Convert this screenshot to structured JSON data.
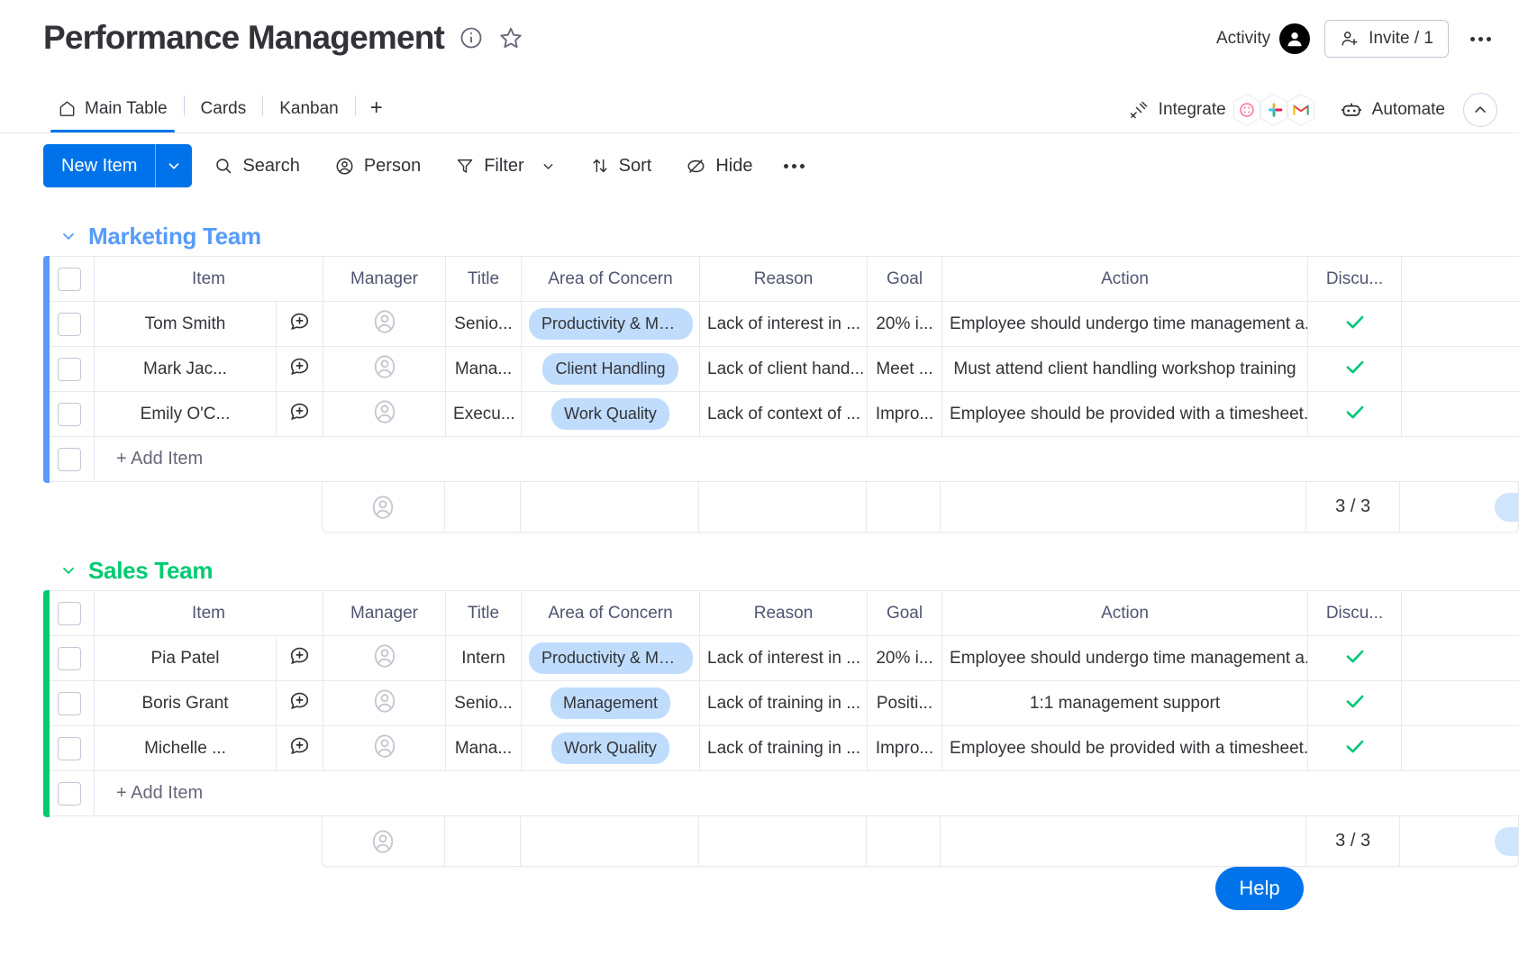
{
  "header": {
    "title": "Performance Management",
    "info_icon": "info-circle-icon",
    "star_icon": "star-icon",
    "activity_label": "Activity",
    "invite_label": "Invite / 1",
    "more_menu": "more-options-icon"
  },
  "tabs": {
    "items": [
      {
        "label": "Main Table",
        "icon": "home-icon",
        "active": true
      },
      {
        "label": "Cards",
        "icon": "",
        "active": false
      },
      {
        "label": "Kanban",
        "icon": "",
        "active": false
      }
    ],
    "add_label": "+",
    "integrate_label": "Integrate",
    "integrate_icons": [
      "monday-integration-icon",
      "slack-icon",
      "gmail-icon"
    ],
    "automate_label": "Automate",
    "collapse_icon": "chevron-up-icon"
  },
  "toolbar": {
    "new_item_label": "New Item",
    "new_item_caret": "chevron-down-icon",
    "search_label": "Search",
    "person_label": "Person",
    "filter_label": "Filter",
    "filter_caret": "chevron-down-icon",
    "sort_label": "Sort",
    "hide_label": "Hide",
    "more_label": "more-actions-icon"
  },
  "columns": [
    "Item",
    "",
    "Manager",
    "Title",
    "Area of Concern",
    "Reason",
    "Goal",
    "Action",
    "Discu..."
  ],
  "groups": [
    {
      "name": "Marketing Team",
      "color": "#579bfc",
      "add_item_label": "+ Add Item",
      "summary_count": "3 / 3",
      "rows": [
        {
          "item": "Tom Smith",
          "title": "Senio...",
          "area": "Productivity & Mo...",
          "reason": "Lack of interest in ...",
          "goal": "20% i...",
          "action": "Employee should undergo time management a...",
          "discussed": true
        },
        {
          "item": "Mark Jac...",
          "title": "Mana...",
          "area": "Client Handling",
          "reason": "Lack of client hand...",
          "goal": "Meet ...",
          "action": "Must attend client handling workshop training",
          "discussed": true
        },
        {
          "item": "Emily O'C...",
          "title": "Execu...",
          "area": "Work Quality",
          "reason": "Lack of context of ...",
          "goal": "Impro...",
          "action": "Employee should be provided with a timesheet...",
          "discussed": true
        }
      ]
    },
    {
      "name": "Sales Team",
      "color": "#00ca72",
      "add_item_label": "+ Add Item",
      "summary_count": "3 / 3",
      "rows": [
        {
          "item": "Pia Patel",
          "title": "Intern",
          "area": "Productivity & Mo...",
          "reason": "Lack of interest in ...",
          "goal": "20% i...",
          "action": "Employee should undergo time management a...",
          "discussed": true
        },
        {
          "item": "Boris Grant",
          "title": "Senio...",
          "area": "Management",
          "reason": "Lack of training in ...",
          "goal": "Positi...",
          "action": "1:1 management support",
          "discussed": true
        },
        {
          "item": "Michelle ...",
          "title": "Mana...",
          "area": "Work Quality",
          "reason": "Lack of training in ...",
          "goal": "Impro...",
          "action": "Employee should be provided with a timesheet...",
          "discussed": true
        }
      ]
    }
  ],
  "help": {
    "label": "Help"
  },
  "colors": {
    "accent": "#0073ea",
    "pill_bg": "#bfdcfd",
    "check_green": "#00c875",
    "marketing_bar": "#579bfc",
    "sales_bar": "#00ca72"
  }
}
